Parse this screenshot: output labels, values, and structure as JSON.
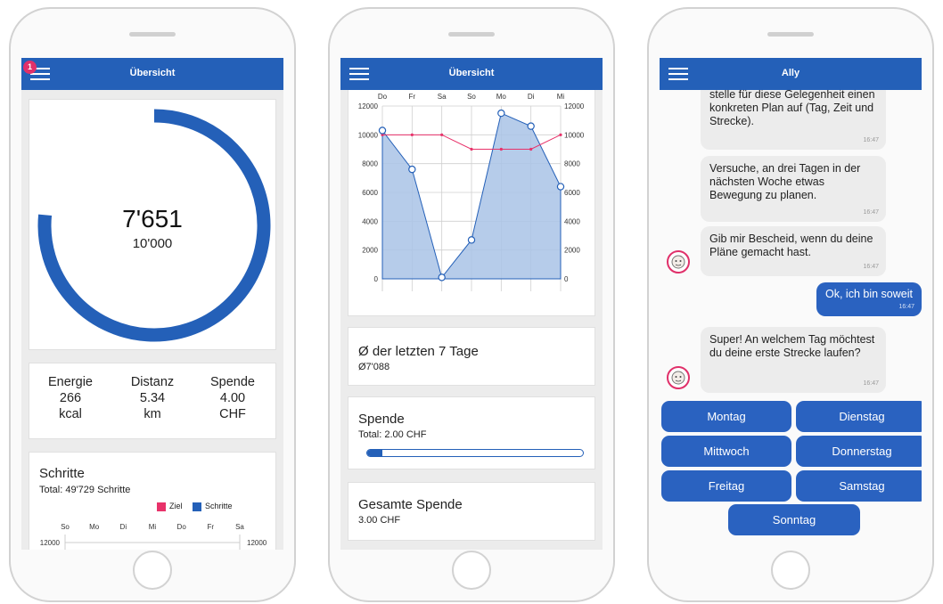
{
  "phone1": {
    "title": "Übersicht",
    "notification_count": "1",
    "ring": {
      "steps_value": "7'651",
      "goal_value": "10'000",
      "progress_fraction": 0.7651
    },
    "stats": [
      {
        "label": "Energie",
        "value": "266",
        "unit": "kcal"
      },
      {
        "label": "Distanz",
        "value": "5.34",
        "unit": "km"
      },
      {
        "label": "Spende",
        "value": "4.00",
        "unit": "CHF"
      }
    ],
    "steps_card": {
      "title": "Schritte",
      "total": "Total: 49'729 Schritte",
      "legend": [
        {
          "label": "Ziel",
          "color": "#e8326a"
        },
        {
          "label": "Schritte",
          "color": "#2460b8"
        }
      ],
      "days": [
        "So",
        "Mo",
        "Di",
        "Mi",
        "Do",
        "Fr",
        "Sa"
      ],
      "y_label_left": "12000",
      "y_label_right": "12000"
    }
  },
  "phone2": {
    "title": "Übersicht",
    "chart_data": {
      "type": "area",
      "categories": [
        "Do",
        "Fr",
        "Sa",
        "So",
        "Mo",
        "Di",
        "Mi"
      ],
      "series": [
        {
          "values": [
            10300,
            7600,
            100,
            2700,
            11500,
            10600,
            6400
          ],
          "color": "#2460b8"
        },
        {
          "values": [
            10000,
            10000,
            10000,
            9000,
            9000,
            9000,
            10000
          ],
          "color": "#e8326a"
        }
      ],
      "yticks": [
        0,
        2000,
        4000,
        6000,
        8000,
        10000,
        12000
      ],
      "ylim": [
        0,
        12000
      ],
      "grid": true
    },
    "avg_card": {
      "title": "Ø der letzten 7 Tage",
      "value": "Ø7'088"
    },
    "donation_card": {
      "title": "Spende",
      "total": "Total: 2.00 CHF",
      "progress_fraction": 0.07
    },
    "total_donation_card": {
      "title": "Gesamte Spende",
      "value": "3.00 CHF"
    }
  },
  "phone3": {
    "title": "Ally",
    "messages": [
      {
        "text": "stelle für diese Gelegenheit einen konkreten Plan auf (Tag, Zeit und Strecke).",
        "time": "16:47"
      },
      {
        "text": "Versuche, an drei Tagen in der nächsten Woche etwas Bewegung zu planen.",
        "time": "16:47"
      },
      {
        "text": "Gib mir Bescheid, wenn du deine Pläne gemacht hast.",
        "time": "16:47"
      },
      {
        "text": "Ok, ich bin soweit",
        "time": "16:47"
      },
      {
        "text": "Super! An welchem Tag möchtest du deine erste Strecke laufen?",
        "time": "16:47"
      }
    ],
    "day_buttons": [
      "Montag",
      "Dienstag",
      "Mittwoch",
      "Donnerstag",
      "Freitag",
      "Samstag",
      "Sonntag"
    ]
  },
  "colors": {
    "primary": "#2460b8",
    "goal": "#e8326a",
    "area_fill": "#a9c3e6"
  }
}
